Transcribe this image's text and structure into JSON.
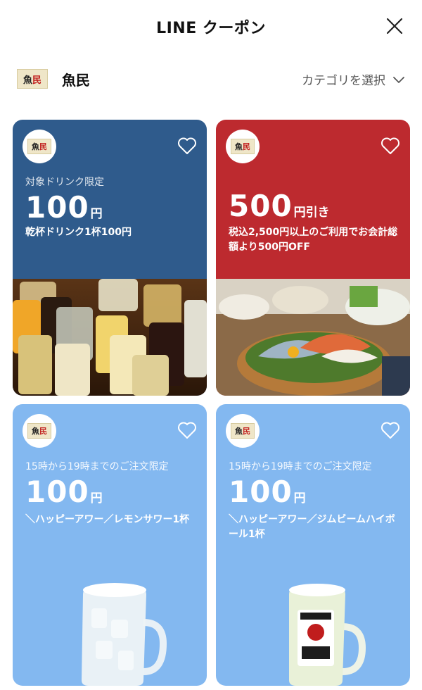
{
  "header": {
    "title": "LINE クーポン",
    "close_icon": "close-icon"
  },
  "store": {
    "logo_text_a": "魚",
    "logo_text_b": "民",
    "name": "魚民",
    "category_label": "カテゴリを選択",
    "category_icon": "chevron-down-icon"
  },
  "colors": {
    "card_blue_dark": "#2f5b8c",
    "card_red": "#bd2a2f",
    "card_blue_light": "#83b8f0"
  },
  "coupons": [
    {
      "condition": "対象ドリンク限定",
      "amount": "100",
      "unit": "円",
      "description": "乾杯ドリンク1杯100円",
      "image": "drinks-photo",
      "favorite_icon": "heart-outline-icon"
    },
    {
      "condition": "",
      "amount": "500",
      "unit": "円引き",
      "description": "税込2,500円以上のご利用でお会計総額より500円OFF",
      "image": "sashimi-platter-photo",
      "favorite_icon": "heart-outline-icon"
    },
    {
      "condition": "15時から19時までのご注文限定",
      "amount": "100",
      "unit": "円",
      "description": "＼ハッピーアワー／レモンサワー1杯",
      "image": "lemon-sour-mug-photo",
      "favorite_icon": "heart-outline-icon"
    },
    {
      "condition": "15時から19時までのご注文限定",
      "amount": "100",
      "unit": "円",
      "description": "＼ハッピーアワー／ジムビームハイボール1杯",
      "image": "jim-beam-highball-mug-photo",
      "favorite_icon": "heart-outline-icon"
    }
  ]
}
